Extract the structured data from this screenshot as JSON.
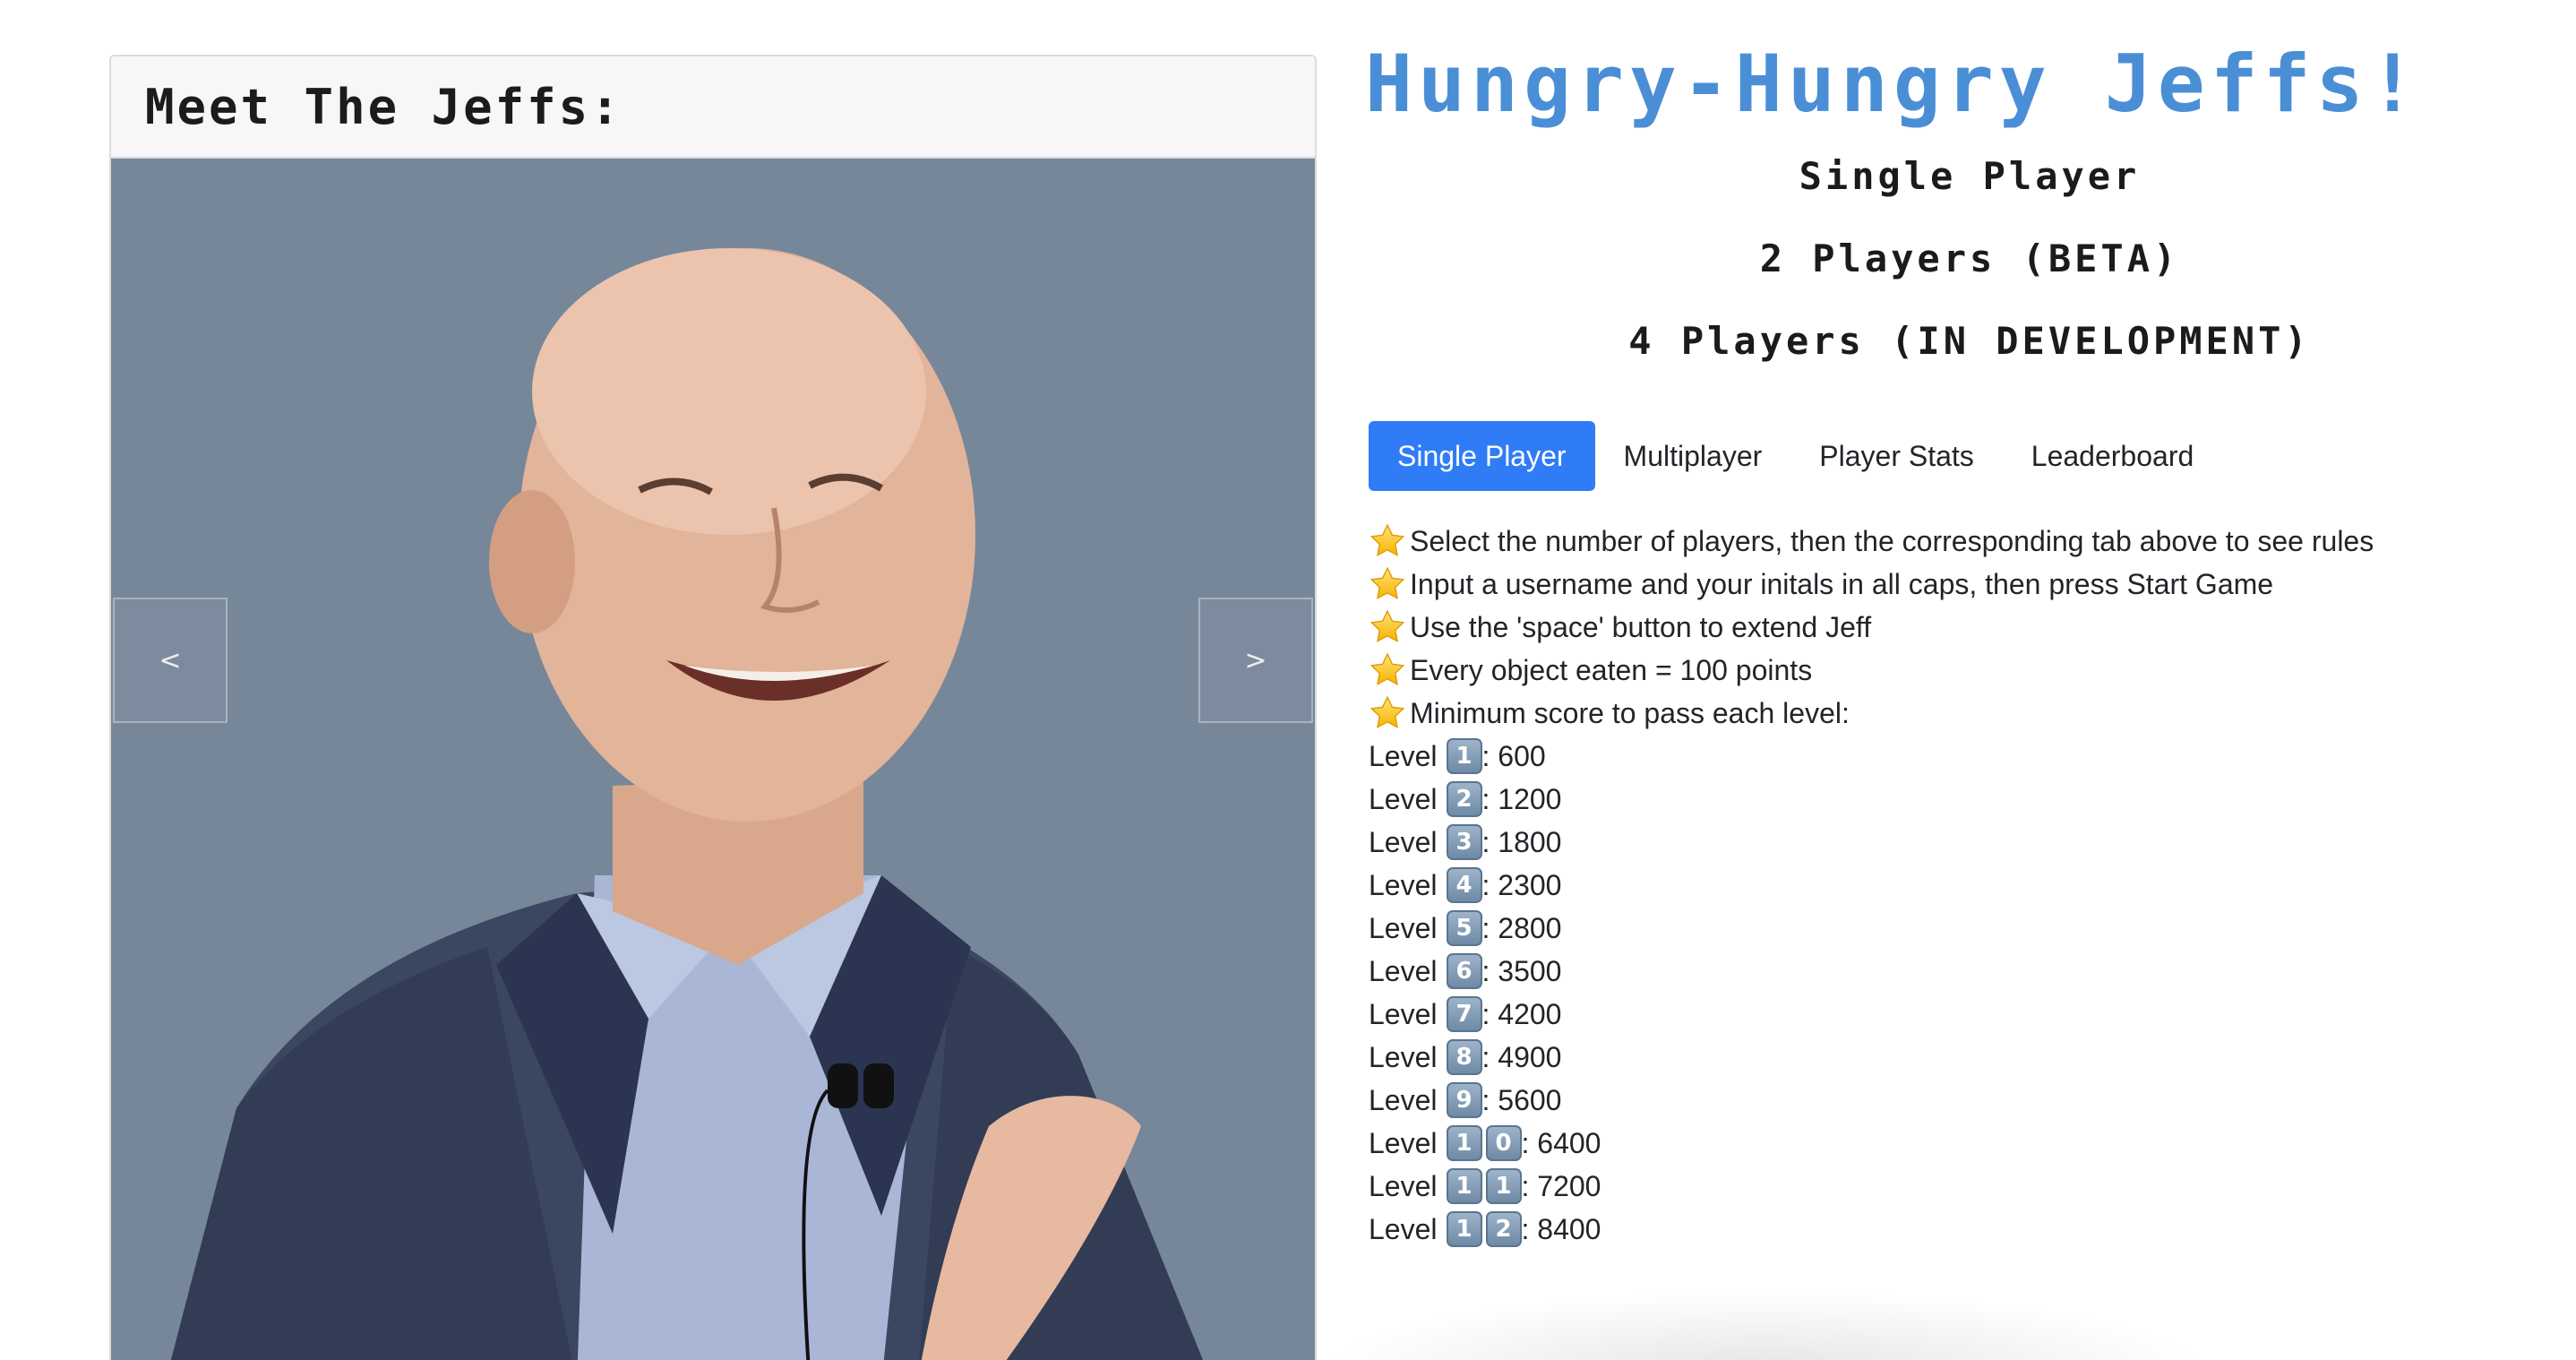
{
  "card": {
    "title": "Meet The Jeffs:",
    "prev_label": "<",
    "next_label": ">"
  },
  "header": {
    "title": "Hungry-Hungry Jeffs!",
    "modes": [
      "Single Player",
      "2 Players (BETA)",
      "4 Players (IN DEVELOPMENT)"
    ]
  },
  "tabs": [
    {
      "label": "Single Player",
      "active": true
    },
    {
      "label": "Multiplayer",
      "active": false
    },
    {
      "label": "Player Stats",
      "active": false
    },
    {
      "label": "Leaderboard",
      "active": false
    }
  ],
  "rules": [
    "Select the number of players, then the corresponding tab above to see rules",
    "Input a username and your initals in all caps, then press Start Game",
    "Use the 'space' button to extend Jeff",
    "Every object eaten = 100 points",
    "Minimum score to pass each level:"
  ],
  "levels": [
    {
      "label": "Level",
      "digits": [
        "1"
      ],
      "score": ": 600"
    },
    {
      "label": "Level",
      "digits": [
        "2"
      ],
      "score": ": 1200"
    },
    {
      "label": "Level",
      "digits": [
        "3"
      ],
      "score": ": 1800"
    },
    {
      "label": "Level",
      "digits": [
        "4"
      ],
      "score": ": 2300"
    },
    {
      "label": "Level",
      "digits": [
        "5"
      ],
      "score": ": 2800"
    },
    {
      "label": "Level",
      "digits": [
        "6"
      ],
      "score": ": 3500"
    },
    {
      "label": "Level",
      "digits": [
        "7"
      ],
      "score": ": 4200"
    },
    {
      "label": "Level",
      "digits": [
        "8"
      ],
      "score": ": 4900"
    },
    {
      "label": "Level",
      "digits": [
        "9"
      ],
      "score": ": 5600"
    },
    {
      "label": "Level",
      "digits": [
        "1",
        "0"
      ],
      "score": ": 6400"
    },
    {
      "label": "Level",
      "digits": [
        "1",
        "1"
      ],
      "score": ": 7200"
    },
    {
      "label": "Level",
      "digits": [
        "1",
        "2"
      ],
      "score": ": 8400"
    }
  ],
  "colors": {
    "title": "#4a8fd6",
    "active_tab": "#2f7cf6",
    "carousel_bg": "#77879a"
  },
  "icons": {
    "rule_bullet": "star-icon",
    "level_digit": "keycap-digit-icon"
  }
}
